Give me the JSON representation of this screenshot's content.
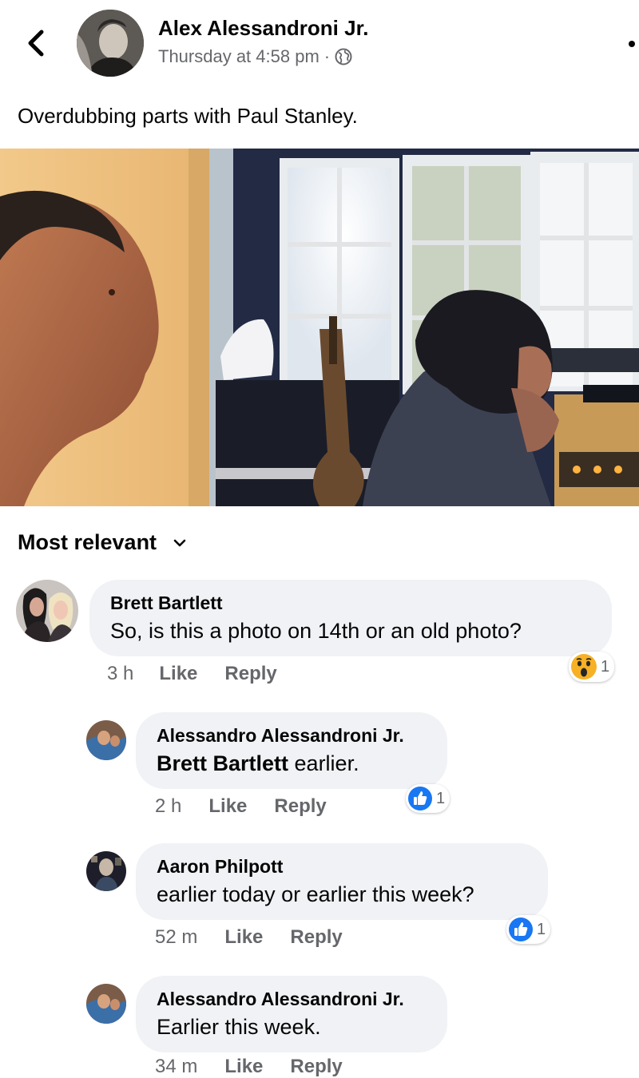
{
  "header": {
    "back_icon": "chevron-left-icon",
    "author": "Alex Alessandroni Jr.",
    "timestamp": "Thursday at 4:58 pm",
    "separator": "·",
    "privacy_icon": "globe-icon",
    "more_icon": "more-dot-icon"
  },
  "post": {
    "caption": "Overdubbing parts with Paul Stanley."
  },
  "comments_section": {
    "sort_label": "Most relevant",
    "sort_icon": "chevron-down-icon",
    "comments": [
      {
        "author": "Brett Bartlett",
        "text": "So, is this a photo on 14th or an old photo?",
        "time": "3 h",
        "like_label": "Like",
        "reply_label": "Reply",
        "reaction_icon": "wow-reaction-icon",
        "reaction_count": "1"
      },
      {
        "author": "Alessandro Alessandroni Jr.",
        "mention": "Brett Bartlett",
        "text": " earlier.",
        "time": "2 h",
        "like_label": "Like",
        "reply_label": "Reply",
        "reaction_icon": "like-reaction-icon",
        "reaction_count": "1"
      },
      {
        "author": "Aaron Philpott",
        "text": "earlier today or earlier this week?",
        "time": "52 m",
        "like_label": "Like",
        "reply_label": "Reply",
        "reaction_icon": "like-reaction-icon",
        "reaction_count": "1"
      },
      {
        "author": "Alessandro Alessandroni Jr.",
        "text": "Earlier this week.",
        "time": "34 m",
        "like_label": "Like",
        "reply_label": "Reply"
      }
    ]
  },
  "colors": {
    "text_primary": "#050505",
    "text_secondary": "#65676b",
    "bubble_bg": "#f0f2f5",
    "like_blue": "#1877f2",
    "wow_yellow": "#f7b125"
  }
}
